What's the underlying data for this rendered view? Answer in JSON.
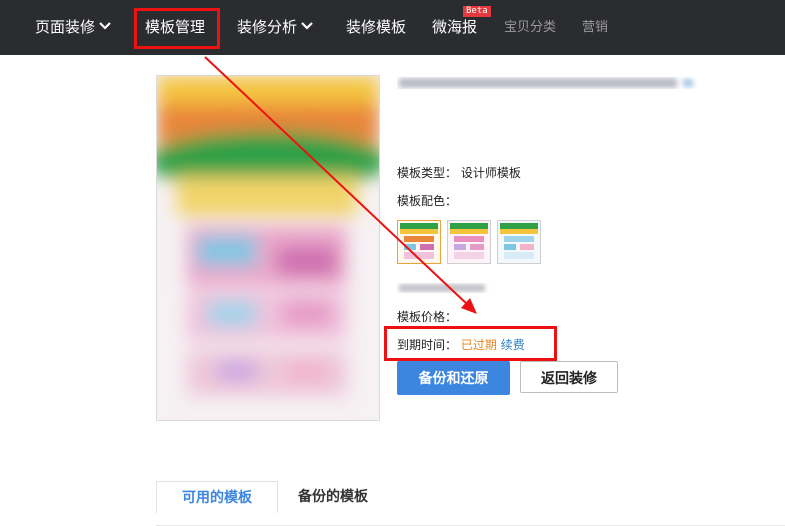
{
  "nav": {
    "items": [
      {
        "label": "页面装修",
        "dropdown": true
      },
      {
        "label": "模板管理",
        "dropdown": false
      },
      {
        "label": "装修分析",
        "dropdown": true
      },
      {
        "label": "装修模板",
        "dropdown": false
      },
      {
        "label": "微海报",
        "dropdown": false
      },
      {
        "label": "宝贝分类",
        "dropdown": false
      },
      {
        "label": "营销",
        "dropdown": false
      }
    ],
    "beta_badge": "Beta"
  },
  "template": {
    "type_label": "模板类型：",
    "type_value": "设计师模板",
    "color_label": "模板配色：",
    "price_label": "模板价格：",
    "expiry_label": "到期时间：",
    "expiry_status": "已过期",
    "renew_link": "续费"
  },
  "actions": {
    "backup_restore": "备份和还原",
    "back_to_decorate": "返回装修"
  },
  "tabs": [
    {
      "label": "可用的模板",
      "active": true
    },
    {
      "label": "备份的模板",
      "active": false
    }
  ],
  "colors": {
    "nav_bg": "#2b2c30",
    "primary": "#3d86e0",
    "expired": "#e8851c",
    "link": "#2a7fc1",
    "annotation": "#ee1111"
  }
}
